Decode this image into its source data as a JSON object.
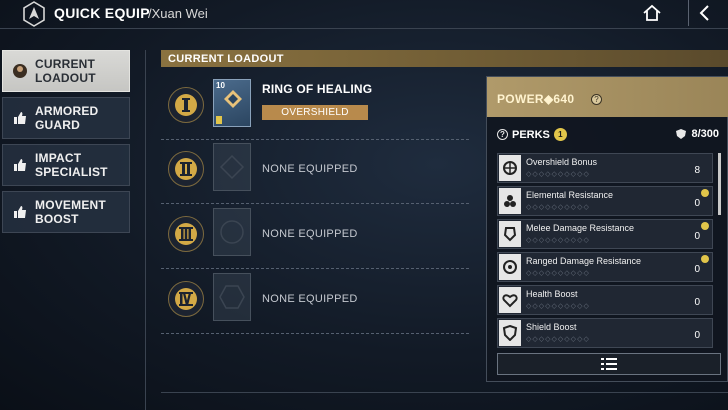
{
  "header": {
    "title": "QUICK EQUIP",
    "subtitle": "/Xuan Wei"
  },
  "nav": {
    "items": [
      {
        "label": "CURRENT\nLOADOUT",
        "active": true
      },
      {
        "label": "ARMORED\nGUARD",
        "active": false
      },
      {
        "label": "IMPACT\nSPECIALIST",
        "active": false
      },
      {
        "label": "MOVEMENT\nBOOST",
        "active": false
      }
    ]
  },
  "loadout": {
    "section_title": "CURRENT LOADOUT",
    "slots": [
      {
        "numeral": "I",
        "name": "RING OF HEALING",
        "level": "10",
        "perk": "OVERSHIELD"
      },
      {
        "numeral": "II",
        "name": "NONE EQUIPPED"
      },
      {
        "numeral": "III",
        "name": "NONE EQUIPPED"
      },
      {
        "numeral": "IV",
        "name": "NONE EQUIPPED"
      }
    ]
  },
  "panel": {
    "power_label": "POWER",
    "power_value": "640",
    "perks_label": "PERKS",
    "perks_count": "1",
    "capacity": "8/300",
    "perks": [
      {
        "name": "Overshield Bonus",
        "value": "8",
        "icon": "overshield-icon",
        "locked": false
      },
      {
        "name": "Elemental Resistance",
        "value": "0",
        "icon": "elemental-icon",
        "locked": true
      },
      {
        "name": "Melee Damage Resistance",
        "value": "0",
        "icon": "melee-icon",
        "locked": true
      },
      {
        "name": "Ranged Damage Resistance",
        "value": "0",
        "icon": "ranged-icon",
        "locked": true
      },
      {
        "name": "Health Boost",
        "value": "0",
        "icon": "health-icon",
        "locked": false
      },
      {
        "name": "Shield Boost",
        "value": "0",
        "icon": "shield-icon",
        "locked": false
      }
    ],
    "dots": "◇◇◇◇◇◇◇◇◇◇"
  },
  "colors": {
    "gold": "#b88a4c",
    "power_bar": "#b09a6a",
    "active_nav": "#d9d9d6"
  }
}
